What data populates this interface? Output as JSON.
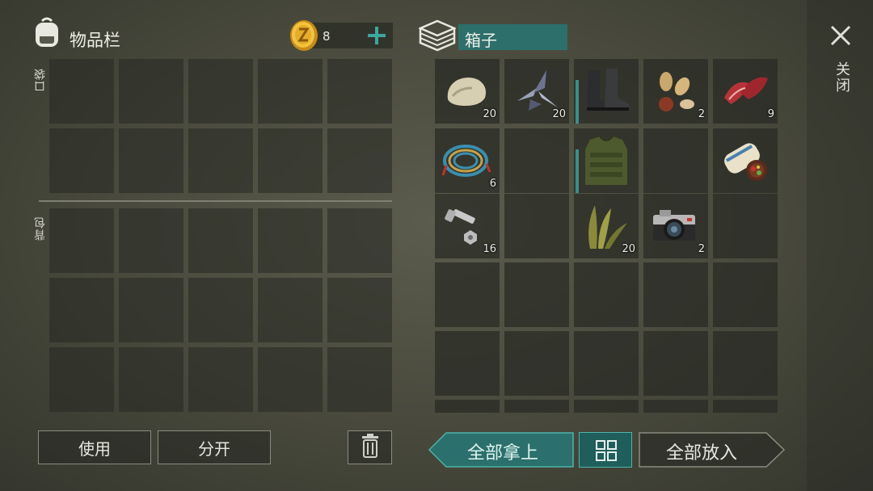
{
  "inventory": {
    "title": "物品栏",
    "coin_count": "8",
    "pocket_label": "口袋",
    "backpack_label": "背包"
  },
  "container": {
    "title": "箱子",
    "items": [
      {
        "name": "stone",
        "qty": "20",
        "icon": "stone-icon"
      },
      {
        "name": "metal-shards",
        "qty": "20",
        "icon": "metal-shards-icon"
      },
      {
        "name": "boots",
        "qty": "",
        "icon": "boots-icon",
        "equip_marker": true
      },
      {
        "name": "nuts",
        "qty": "2",
        "icon": "nuts-icon"
      },
      {
        "name": "raw-meat",
        "qty": "9",
        "icon": "meat-icon"
      },
      {
        "name": "rope",
        "qty": "6",
        "icon": "rope-icon"
      },
      {
        "name": "empty",
        "qty": "",
        "icon": ""
      },
      {
        "name": "vest",
        "qty": "",
        "icon": "vest-icon",
        "equip_marker": true
      },
      {
        "name": "empty",
        "qty": "",
        "icon": ""
      },
      {
        "name": "recipe-scroll",
        "qty": "",
        "icon": "scroll-icon"
      },
      {
        "name": "bolts",
        "qty": "16",
        "icon": "bolts-icon"
      },
      {
        "name": "empty",
        "qty": "",
        "icon": ""
      },
      {
        "name": "plant-fiber",
        "qty": "20",
        "icon": "plant-fiber-icon"
      },
      {
        "name": "camera",
        "qty": "2",
        "icon": "camera-icon"
      },
      {
        "name": "empty",
        "qty": "",
        "icon": ""
      }
    ]
  },
  "actions": {
    "use": "使用",
    "split": "分开",
    "take_all": "全部拿上",
    "put_all": "全部放入",
    "close": "关闭"
  },
  "colors": {
    "accent": "#2f8f8a",
    "coin": "#e0a92a",
    "accent_dark": "#1f5e5b"
  }
}
